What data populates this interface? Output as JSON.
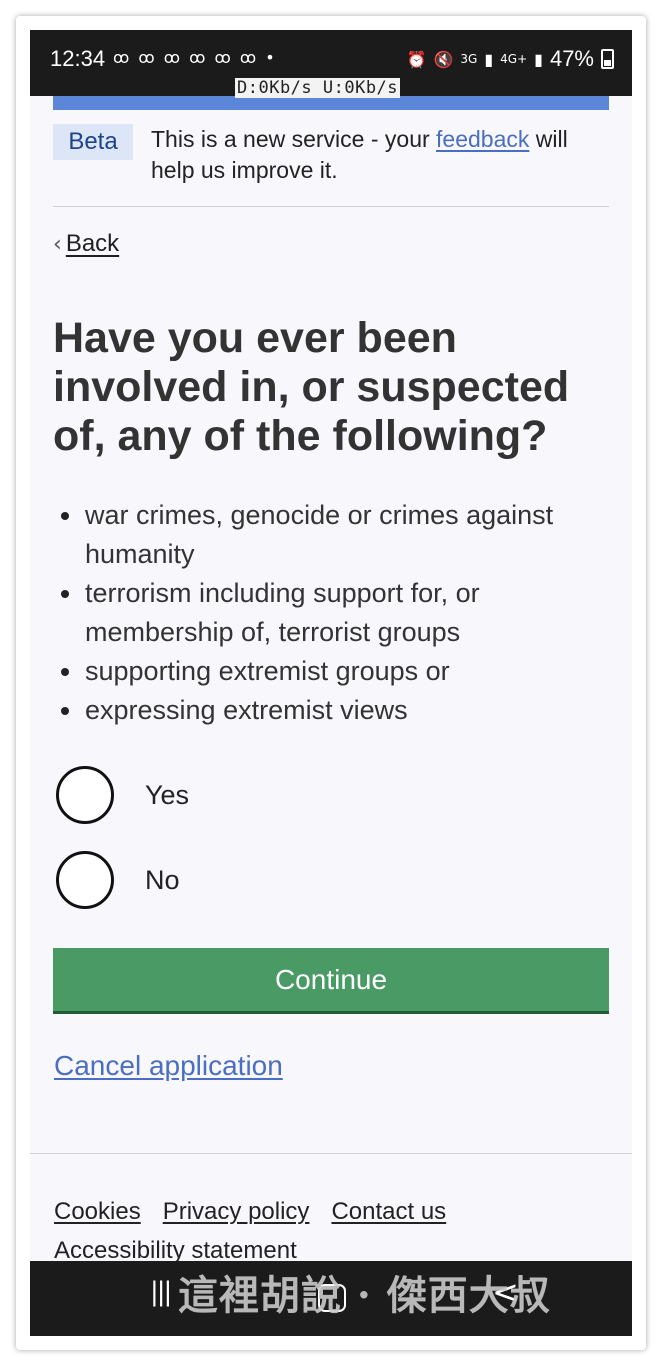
{
  "status_bar": {
    "time": "12:34",
    "notifications": "ꝏ ꝏ ꝏ ꝏ ꝏ ꝏ •",
    "network_3g": "3G",
    "network_4g": "4G+",
    "battery": "47%",
    "net_speed": "D:0Kb/s  U:0Kb/s"
  },
  "beta_banner": {
    "tag": "Beta",
    "text_before": "This is a new service - your ",
    "link": "feedback",
    "text_after": " will help us improve it."
  },
  "back_link": "Back",
  "question": {
    "heading": "Have you ever been involved in, or suspected of, any of the following?",
    "items": [
      "war crimes, genocide or crimes against humanity",
      "terrorism including support for, or membership of, terrorist groups",
      "supporting extremist groups or",
      "expressing extremist views"
    ],
    "options": [
      {
        "label": "Yes"
      },
      {
        "label": "No"
      }
    ]
  },
  "continue_button": "Continue",
  "cancel_link": "Cancel application",
  "footer": {
    "links": [
      "Cookies",
      "Privacy policy",
      "Contact us",
      "Accessibility statement"
    ]
  },
  "nav_bar": {
    "recent": "|||",
    "back": "<"
  },
  "watermark": "這裡胡說 · 傑西大叔",
  "colors": {
    "accent_blue": "#5c86d8",
    "button_green": "#4a9a66",
    "link_blue": "#4a6fc1"
  }
}
